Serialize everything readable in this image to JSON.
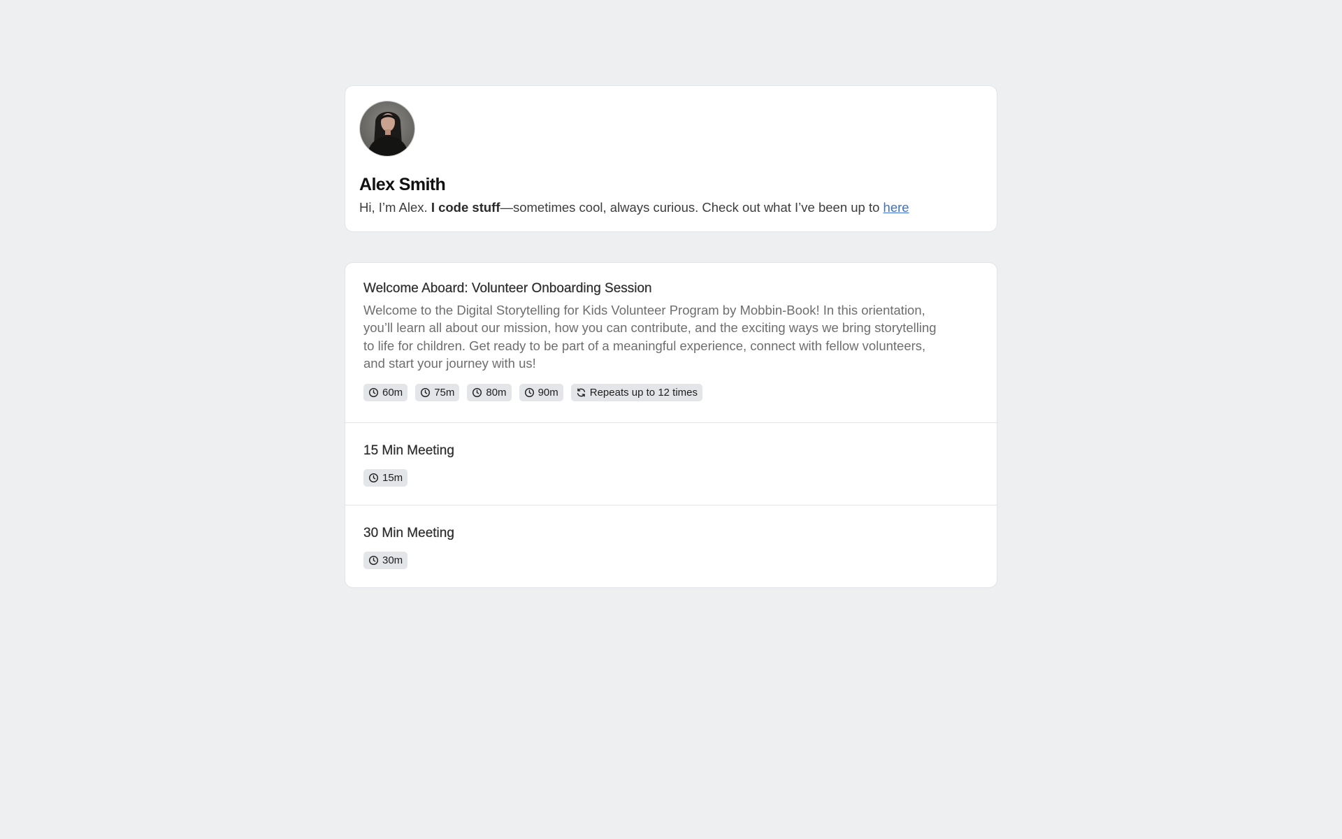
{
  "profile": {
    "name": "Alex Smith",
    "bio_prefix": "Hi, I’m Alex. ",
    "bio_bold": "I code stuff",
    "bio_suffix": "—sometimes cool, always curious. Check out what I’ve been up to ",
    "bio_link": "here"
  },
  "events": [
    {
      "title": "Welcome Aboard: Volunteer Onboarding Session",
      "description": "Welcome to the Digital Storytelling for Kids Volunteer Program by Mobbin-Book! In this orientation, you’ll learn all about our mission, how you can contribute, and the exciting ways we bring storytelling to life for children. Get ready to be part of a meaningful experience, connect with fellow volunteers, and start your journey with us!",
      "durations": [
        "60m",
        "75m",
        "80m",
        "90m"
      ],
      "recurrence": "Repeats up to 12 times"
    },
    {
      "title": "15 Min Meeting",
      "durations": [
        "15m"
      ]
    },
    {
      "title": "30 Min Meeting",
      "durations": [
        "30m"
      ]
    }
  ],
  "icons": {
    "duration": "clock-icon",
    "recurrence": "refresh-icon"
  },
  "colors": {
    "background": "#eeeff1",
    "card": "#ffffff",
    "badge": "#e4e5e8",
    "link": "#3b6fd6"
  }
}
